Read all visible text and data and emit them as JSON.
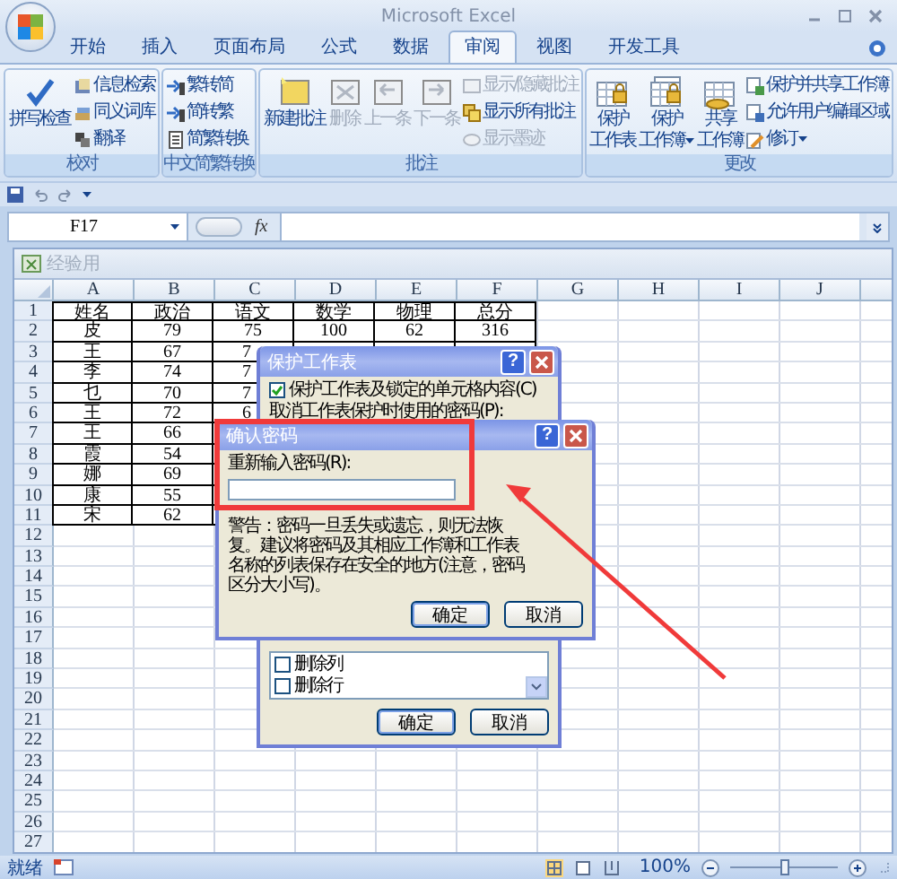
{
  "window": {
    "title": "Microsoft Excel"
  },
  "ribbon_tabs": [
    {
      "label": "开始",
      "selected": false
    },
    {
      "label": "插入",
      "selected": false
    },
    {
      "label": "页面布局",
      "selected": false
    },
    {
      "label": "公式",
      "selected": false
    },
    {
      "label": "数据",
      "selected": false
    },
    {
      "label": "审阅",
      "selected": true
    },
    {
      "label": "视图",
      "selected": false
    },
    {
      "label": "开发工具",
      "selected": false
    }
  ],
  "ribbon_groups": [
    {
      "label": "校对",
      "large": [
        {
          "lines": [
            "拼写检查"
          ],
          "disabled": false,
          "dropdown": false
        }
      ],
      "small": [
        {
          "label": "信息检索",
          "disabled": false,
          "dropdown": false
        },
        {
          "label": "同义词库",
          "disabled": false,
          "dropdown": false
        },
        {
          "label": "翻译",
          "disabled": false,
          "dropdown": false
        }
      ]
    },
    {
      "label": "中文简繁转换",
      "small": [
        {
          "label": "繁转简",
          "disabled": false,
          "dropdown": false
        },
        {
          "label": "简转繁",
          "disabled": false,
          "dropdown": false
        },
        {
          "label": "简繁转换",
          "disabled": false,
          "dropdown": false
        }
      ]
    },
    {
      "label": "批注",
      "large": [
        {
          "lines": [
            "新建批注"
          ],
          "disabled": false,
          "dropdown": false
        },
        {
          "lines": [
            "删除"
          ],
          "disabled": true,
          "dropdown": false
        },
        {
          "lines": [
            "上一条"
          ],
          "disabled": true,
          "dropdown": false
        },
        {
          "lines": [
            "下一条"
          ],
          "disabled": true,
          "dropdown": false
        }
      ],
      "small": [
        {
          "label": "显示/隐藏批注",
          "disabled": true,
          "dropdown": false
        },
        {
          "label": "显示所有批注",
          "disabled": false,
          "dropdown": false
        },
        {
          "label": "显示墨迹",
          "disabled": true,
          "dropdown": false
        }
      ]
    },
    {
      "label": "更改",
      "large": [
        {
          "lines": [
            "保护",
            "工作表"
          ],
          "disabled": false,
          "dropdown": false
        },
        {
          "lines": [
            "保护",
            "工作簿"
          ],
          "disabled": false,
          "dropdown": true
        },
        {
          "lines": [
            "共享",
            "工作簿"
          ],
          "disabled": false,
          "dropdown": false
        }
      ],
      "small": [
        {
          "label": "保护并共享工作簿",
          "disabled": false,
          "dropdown": false
        },
        {
          "label": "允许用户编辑区域",
          "disabled": false,
          "dropdown": false
        },
        {
          "label": "修订",
          "disabled": false,
          "dropdown": true
        }
      ]
    }
  ],
  "formula_bar": {
    "name_box": "F17",
    "function_label": "fx"
  },
  "workbook": {
    "title": "经验用",
    "columns": [
      "A",
      "B",
      "C",
      "D",
      "E",
      "F",
      "G",
      "H",
      "I",
      "J"
    ],
    "rows": [
      {
        "header": "1",
        "cells": [
          "姓名",
          "政治",
          "语文",
          "数学",
          "物理",
          "总分"
        ]
      },
      {
        "header": "2",
        "cells": [
          "皮",
          "79",
          "75",
          "100",
          "62",
          "316"
        ]
      },
      {
        "header": "3",
        "cells": [
          "王",
          "67",
          "7"
        ],
        "cut_last": true
      },
      {
        "header": "4",
        "cells": [
          "李",
          "74",
          "7"
        ],
        "cut_last": true
      },
      {
        "header": "5",
        "cells": [
          "乜",
          "70",
          "7"
        ],
        "cut_last": true
      },
      {
        "header": "6",
        "cells": [
          "王",
          "72",
          "6"
        ],
        "cut_last": true
      },
      {
        "header": "7",
        "cells": [
          "王",
          "66"
        ]
      },
      {
        "header": "8",
        "cells": [
          "霞",
          "54"
        ]
      },
      {
        "header": "9",
        "cells": [
          "娜",
          "69"
        ]
      },
      {
        "header": "10",
        "cells": [
          "康",
          "55"
        ]
      },
      {
        "header": "11",
        "cells": [
          "宋",
          "62"
        ]
      },
      {
        "header": "12"
      },
      {
        "header": "13"
      },
      {
        "header": "14"
      },
      {
        "header": "15"
      },
      {
        "header": "16"
      },
      {
        "header": "17"
      },
      {
        "header": "18"
      },
      {
        "header": "19"
      },
      {
        "header": "20"
      },
      {
        "header": "21"
      },
      {
        "header": "22"
      },
      {
        "header": "23"
      },
      {
        "header": "24"
      },
      {
        "header": "25"
      },
      {
        "header": "26"
      },
      {
        "header": "27"
      }
    ]
  },
  "protect_sheet_dialog": {
    "title": "保护工作表",
    "help_button": "?",
    "protect_checkbox": {
      "label": "保护工作表及锁定的单元格内容(C)",
      "checked": true
    },
    "password_label": "取消工作表保护时使用的密码(P):",
    "permissions": [
      {
        "label": "删除列",
        "checked": false
      },
      {
        "label": "删除行",
        "checked": false
      }
    ],
    "buttons": [
      "确定",
      "取消"
    ]
  },
  "confirm_password_dialog": {
    "title": "确认密码",
    "help_button": "?",
    "password_label": "重新输入密码(R):",
    "warning": "警告：密码一旦丢失或遗忘，则无法恢复。建议将密码及其相应工作簿和工作表名称的列表保存在安全的地方(注意，密码区分大小写)。",
    "buttons": [
      "确定",
      "取消"
    ]
  },
  "status_bar": {
    "status": "就绪",
    "zoom": "100%",
    "zoom_slider": {
      "level": 0.5
    }
  }
}
